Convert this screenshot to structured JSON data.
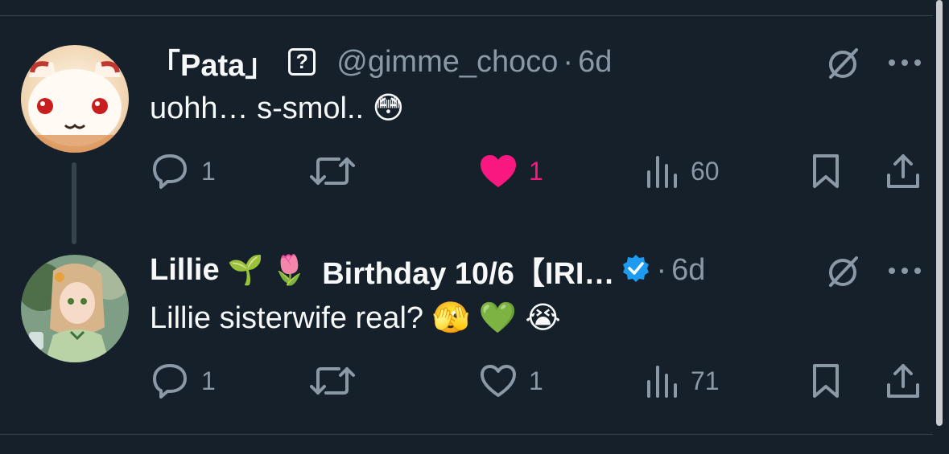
{
  "tweets": [
    {
      "name": "「Pata」",
      "badge": "?",
      "handle": "@gimme_choco",
      "dot": "·",
      "time": "6d",
      "text": "uohh… s-smol.. 😳",
      "avatar": "pata-avatar",
      "replies": "1",
      "retweets": "",
      "likes": "1",
      "liked": true,
      "views": "60"
    },
    {
      "name": "Lillie",
      "name_emoji": "🌱 🌷",
      "name_suffix": "Birthday 10/6【IRI…",
      "verified": true,
      "dot": "·",
      "time": "6d",
      "text": "Lillie sisterwife real? 🫣 💚 😭",
      "avatar": "lillie-avatar",
      "replies": "1",
      "retweets": "",
      "likes": "1",
      "liked": false,
      "views": "71"
    }
  ],
  "colors": {
    "background": "#15202b",
    "text": "#f7f9f9",
    "muted": "#8b98a5",
    "like": "#f91880",
    "verified": "#1d9bf0",
    "divider": "#38444d"
  },
  "icons": [
    "reply-icon",
    "retweet-icon",
    "like-icon",
    "views-icon",
    "bookmark-icon",
    "share-icon",
    "grok-icon",
    "more-icon",
    "verified-icon"
  ]
}
